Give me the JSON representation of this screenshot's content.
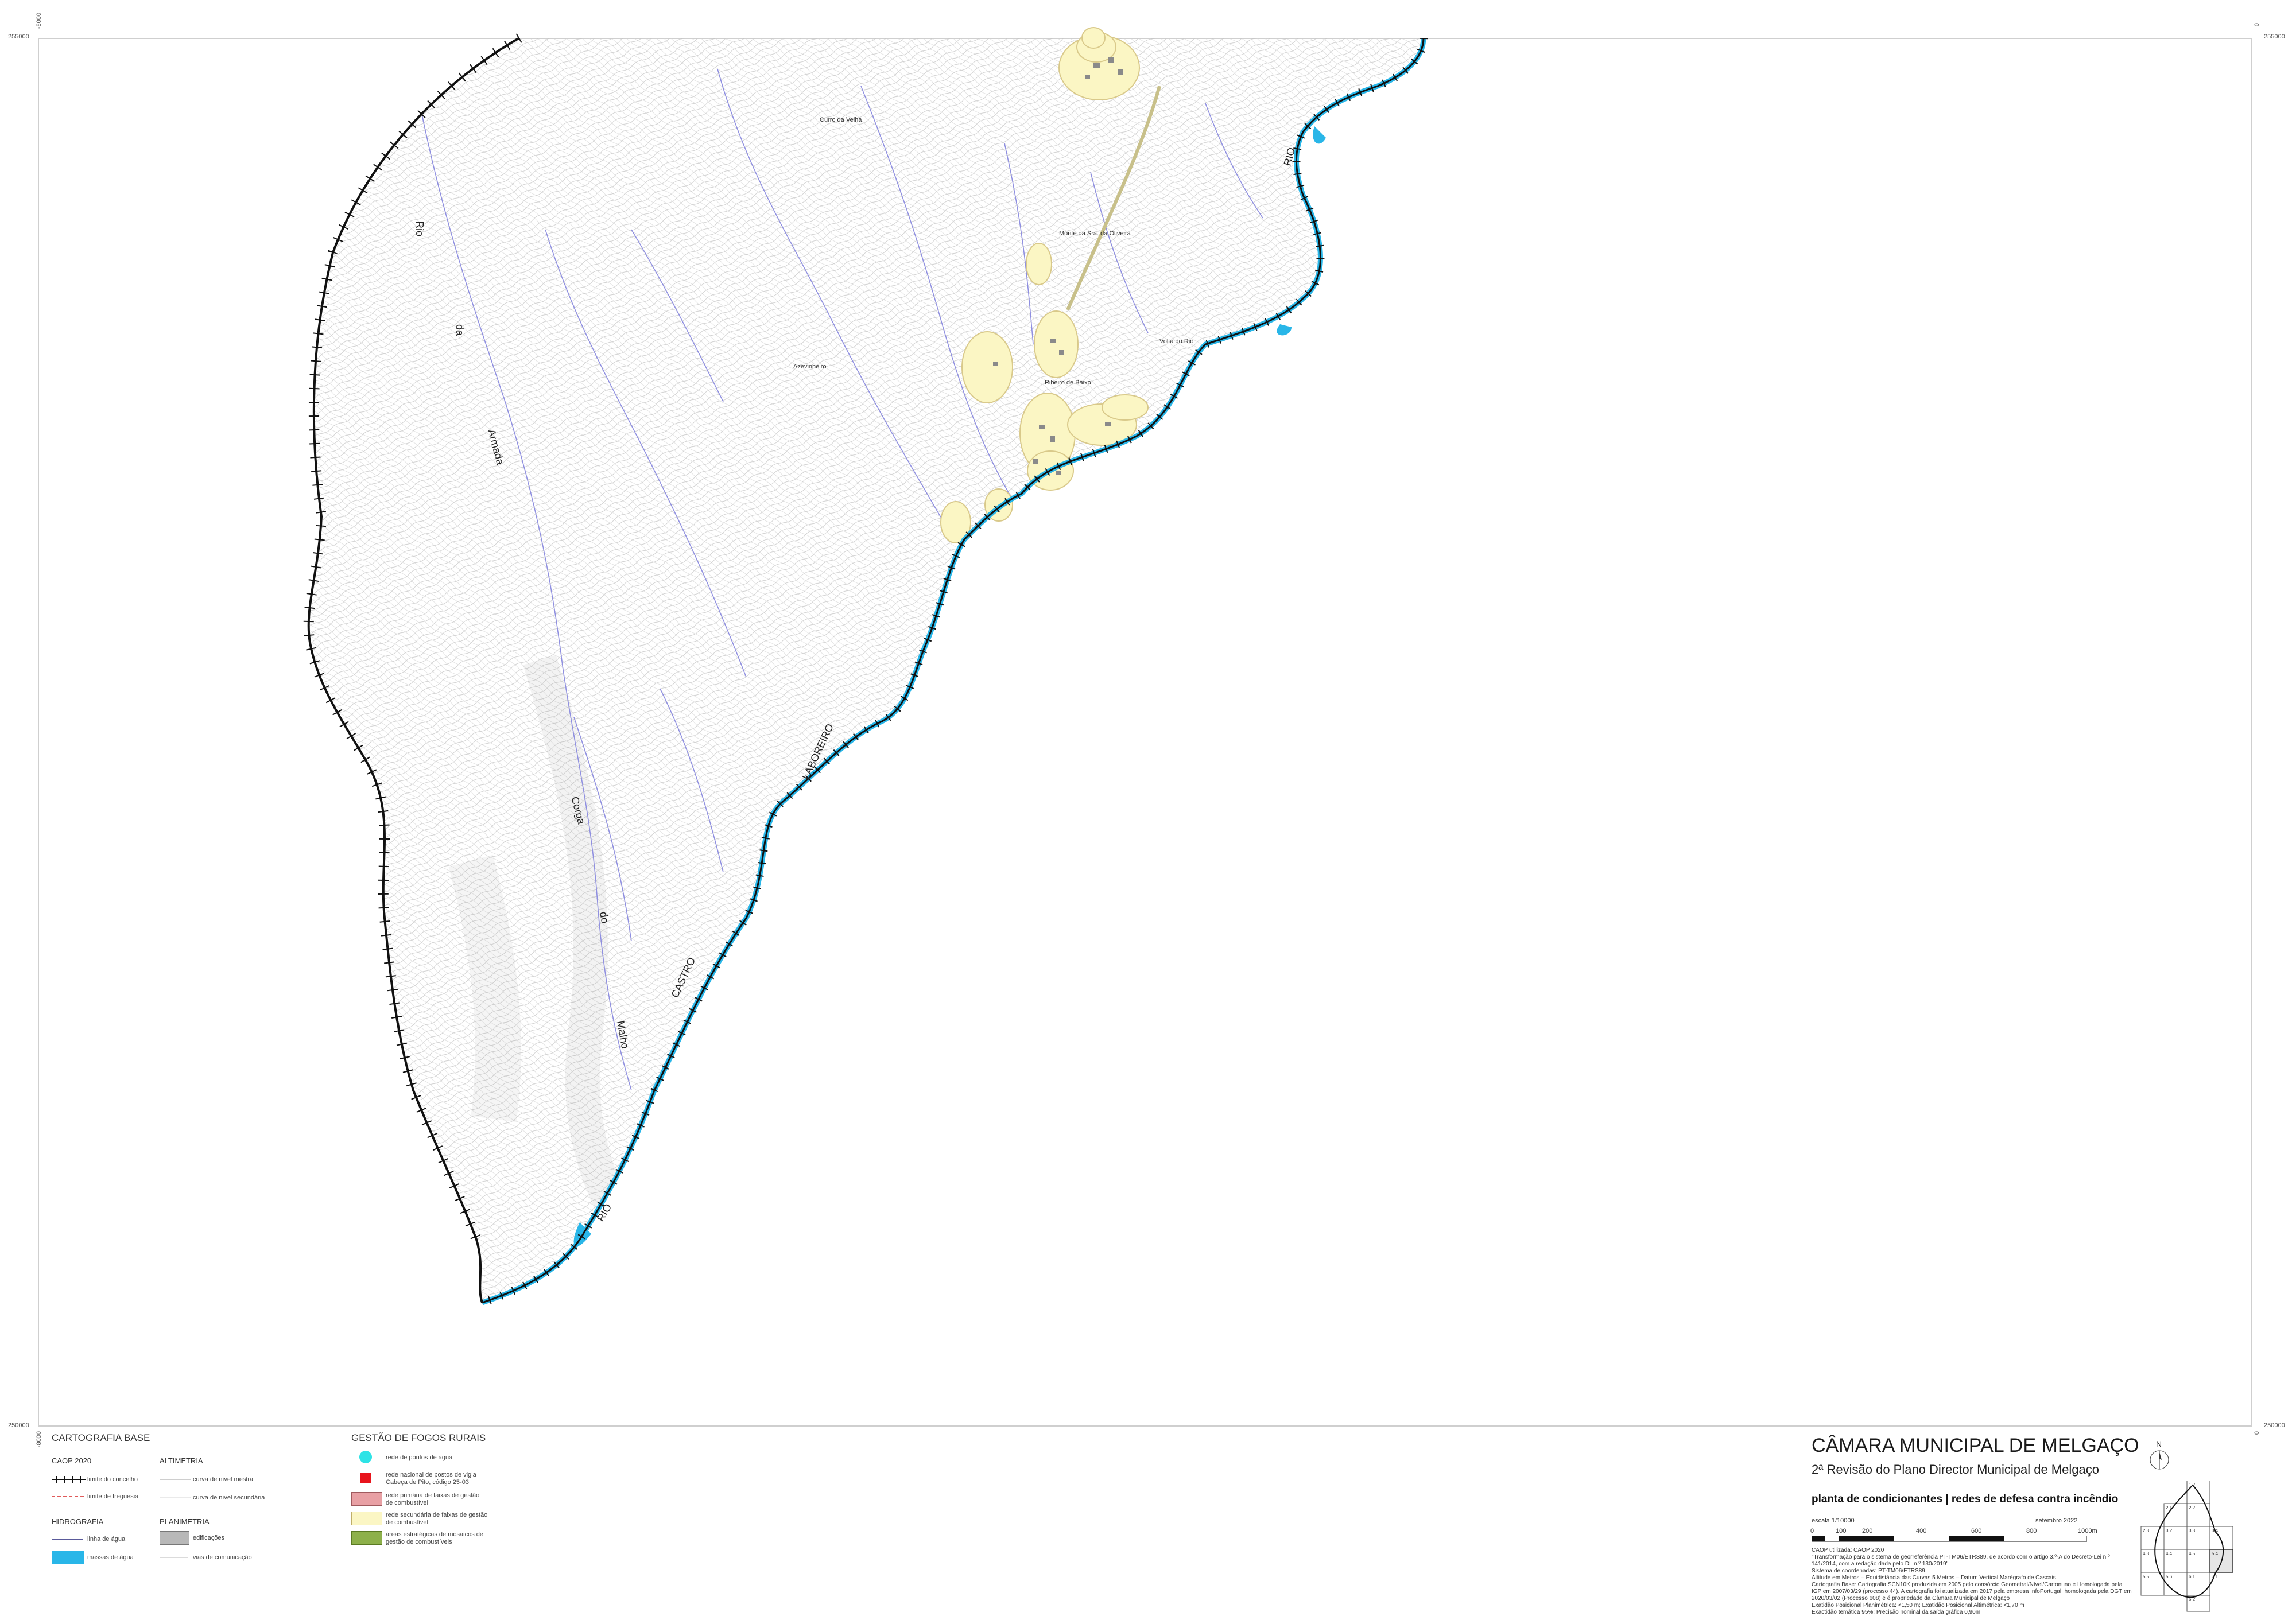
{
  "coordinates": {
    "top_left": "255000",
    "top_right": "255000",
    "bottom_left": "250000",
    "bottom_right": "250000",
    "left_top_vertical": "-8000",
    "left_bottom_vertical": "-8000",
    "right_top_vertical": "0",
    "right_bottom_vertical": "0"
  },
  "map_labels": {
    "curro_da_velha": "Curro da Velha",
    "monte": "Monte da Sra. da Oliveira",
    "volta_do_rio": "Volta do Rio",
    "azevinheiro": "Azevinheiro",
    "ribeiro_de_baixo": "Ribeiro de Baixo",
    "rio_armada_1": "Rio",
    "rio_armada_2": "da",
    "rio_armada_3": "Armada",
    "corga_1": "Corga",
    "corga_2": "do",
    "corga_3": "Malho",
    "laboreiro_rio": "RIO",
    "laboreiro": "LABOREIRO",
    "castro": "CASTRO",
    "rio_bottom": "RIO"
  },
  "legend": {
    "cartografia_title": "CARTOGRAFIA BASE",
    "caop": "CAOP 2020",
    "limite_concelho": "limite do concelho",
    "limite_freguesia": "limite de freguesia",
    "altimetria": "ALTIMETRIA",
    "curva_mestra": "curva de nível mestra",
    "curva_secundaria": "curva de nível secundária",
    "hidrografia": "HIDROGRAFIA",
    "linha_agua": "linha de água",
    "massas_agua": "massas de água",
    "planimetria": "PLANIMETRIA",
    "edificacoes": "edificações",
    "vias": "vias de comunicação",
    "gestao_title": "GESTÃO DE FOGOS RURAIS",
    "pontos_agua": "rede de pontos de água",
    "postos_vigia": "rede nacional de postos de vigia\nCabeça de Pito, código 25-03",
    "rede_primaria": "rede primária de faixas de gestão\nde combustível",
    "rede_secundaria": "rede secundária de faixas de gestão\nde combustível",
    "mosaicos": "áreas estratégicas de mosaicos de\ngestão de combustíveis"
  },
  "title_block": {
    "org": "CÂMARA MUNICIPAL DE MELGAÇO",
    "subtitle": "2ª Revisão do Plano Director Municipal de Melgaço",
    "plan_title": "planta de condicionantes | redes de defesa contra incêndio",
    "escala_label": "escala 1/10000",
    "date": "setembro 2022",
    "scale_ticks": [
      "0",
      "100",
      "200",
      "400",
      "600",
      "800",
      "1000m"
    ],
    "north": "N",
    "notes": "CAOP utilizada: CAOP 2020\n\"Transformação para o sistema de georreferência PT-TM06/ETRS89, de acordo com o artigo 3.º-A do Decreto-Lei n.º 141/2014, com a redação dada pelo DL n.º 130/2019\"\nSistema de coordenadas: PT-TM06/ETRS89\nAltitude em Metros – Equidistância das Curvas 5 Metros – Datum Vertical Marégrafo de Cascais\nCartografia Base: Cartografia SCN10K produzida em 2005 pelo consórcio Geometral/Nível/Cartonuno e Homologada pela IGP em 2007/03/29 (processo 44). A cartografia foi atualizada em 2017 pela empresa InfoPortugal, homologada pela DGT em 2020/03/02 (Processo 608) e é propriedade da Câmara Municipal de Melgaço\nExatidão Posicional Planimétrica: <1,50 m; Exatidão Posicional Altimétrica: <1,70 m\nExactidão temática 95%; Precisão nominal da saída gráfica 0,90m"
  },
  "index_map_labels": [
    "1.2",
    "2.1",
    "2.2",
    "2.3",
    "3.2",
    "3.3",
    "3.4",
    "4.3",
    "4.4",
    "4.5",
    "5.4",
    "5.5",
    "5.6",
    "6.1",
    "6.2",
    "7.1"
  ],
  "colors": {
    "water": "#29b6e8",
    "fuel_secondary": "#fbf6c4",
    "fuel_primary": "#e8a0a4",
    "mosaic": "#8db04a",
    "lookout": "#e8141c",
    "water_point": "#2ee3e6",
    "contour": "#b8b8b8",
    "stream": "#8f8fe0"
  }
}
